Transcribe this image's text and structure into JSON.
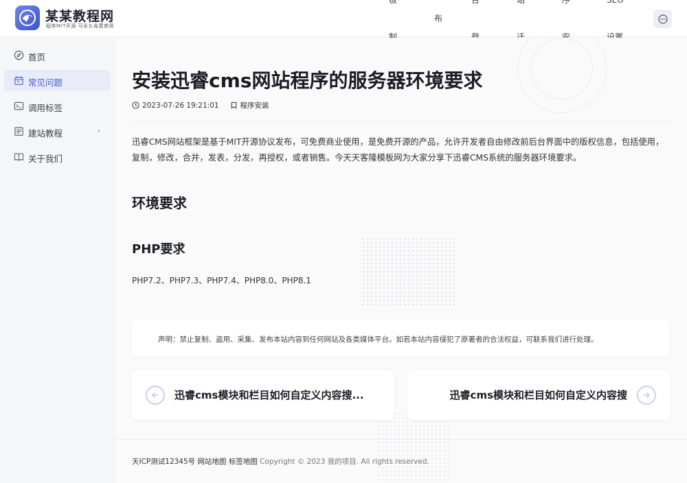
{
  "header": {
    "site_title": "某某教程网",
    "site_slogan": "程序MIT开源 可永久免费商用",
    "nav": [
      "模板制作",
      "瀑布流",
      "后台登录",
      "网站迁移",
      "程序安装",
      "SEO设置"
    ]
  },
  "sidebar": {
    "items": [
      {
        "label": "首页",
        "icon": "compass-icon"
      },
      {
        "label": "常见问题",
        "icon": "calendar-icon",
        "active": true
      },
      {
        "label": "调用标签",
        "icon": "terminal-icon"
      },
      {
        "label": "建站教程",
        "icon": "document-icon",
        "has_submenu": true
      },
      {
        "label": "关于我们",
        "icon": "book-icon"
      }
    ],
    "submenu_arrow": "›"
  },
  "article": {
    "title": "安装迅睿cms网站程序的服务器环境要求",
    "date": "2023-07-26 19:21:01",
    "category": "程序安装",
    "intro": "迅睿CMS网站框架是基于MIT开源协议发布，可免费商业使用，是免费开源的产品，允许开发者自由修改前后台界面中的版权信息，包括使用，复制，修改，合并，发表，分发，再授权，或者销售。今天天客隆模板网为大家分享下迅睿CMS系统的服务器环境要求。",
    "h2": "环境要求",
    "h3": "PHP要求",
    "php_versions": "PHP7.2、PHP7.3、PHP7.4、PHP8.0、PHP8.1"
  },
  "notice": "声明：禁止复制、盗用、采集、发布本站内容到任何网站及各类媒体平台。如若本站内容侵犯了原著者的合法权益，可联系我们进行处理。",
  "prev_next": {
    "prev": "迅睿cms模块和栏目如何自定义内容搜...",
    "next": "迅睿cms模块和栏目如何自定义内容搜"
  },
  "footer": {
    "icp": "天ICP测试12345号",
    "sitemap": "网站地图",
    "tagmap": "标签地图",
    "copyright": "Copyright © 2023 我的项目. All rights reserved."
  },
  "colors": {
    "accent": "#4a5fd0",
    "active_bg": "#e8ebf8",
    "logo": "#3a54c9"
  }
}
